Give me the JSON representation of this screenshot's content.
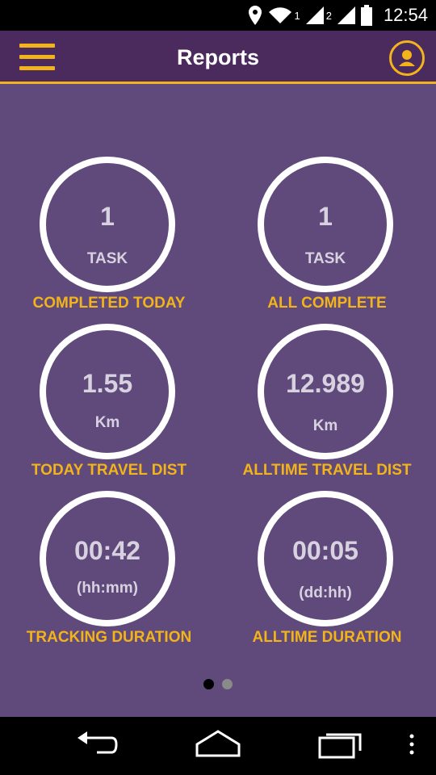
{
  "status_bar": {
    "sim1_label": "1",
    "sim2_label": "2",
    "time": "12:54",
    "icons": [
      "location-icon",
      "wifi-icon",
      "signal-icon",
      "signal-icon",
      "battery-icon"
    ]
  },
  "app_bar": {
    "title": "Reports",
    "menu_icon": "hamburger-menu-icon",
    "profile_icon": "profile-icon",
    "accent_color": "#f2b31b",
    "bg_color": "#4b2a5e"
  },
  "stats": [
    {
      "value": "1",
      "unit": "TASK",
      "label": "COMPLETED TODAY"
    },
    {
      "value": "1",
      "unit": "TASK",
      "label": "ALL COMPLETE"
    },
    {
      "value": "1.55",
      "unit": "Km",
      "label": "TODAY TRAVEL DIST"
    },
    {
      "value": "12.989",
      "unit": "Km",
      "label": "ALLTIME TRAVEL DIST"
    },
    {
      "value": "00:42",
      "unit": "(hh:mm)",
      "label": "TRACKING DURATION"
    },
    {
      "value": "00:05",
      "unit": "(dd:hh)",
      "label": "ALLTIME DURATION"
    }
  ],
  "pager": {
    "pages": 2,
    "active": 1
  },
  "nav_bar": {
    "icons": [
      "back-icon",
      "home-icon",
      "recents-icon",
      "overflow-menu-icon"
    ]
  }
}
